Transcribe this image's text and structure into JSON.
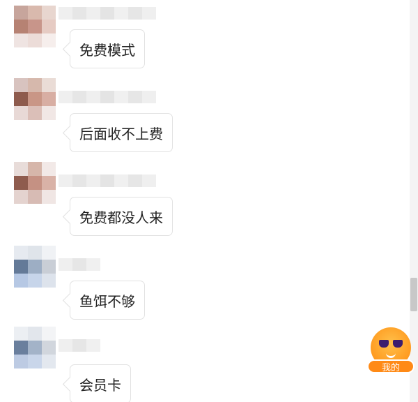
{
  "messages": [
    {
      "text": "免费模式"
    },
    {
      "text": "后面收不上费"
    },
    {
      "text": "免费都没人来"
    },
    {
      "text": "鱼饵不够"
    },
    {
      "text": "会员卡"
    }
  ],
  "floating_button": {
    "label": "我的",
    "icon": "sunglasses-face-icon"
  },
  "colors": {
    "bubble_border": "#e2e2e2",
    "accent_orange": "#ff8a16",
    "text": "#222222"
  }
}
